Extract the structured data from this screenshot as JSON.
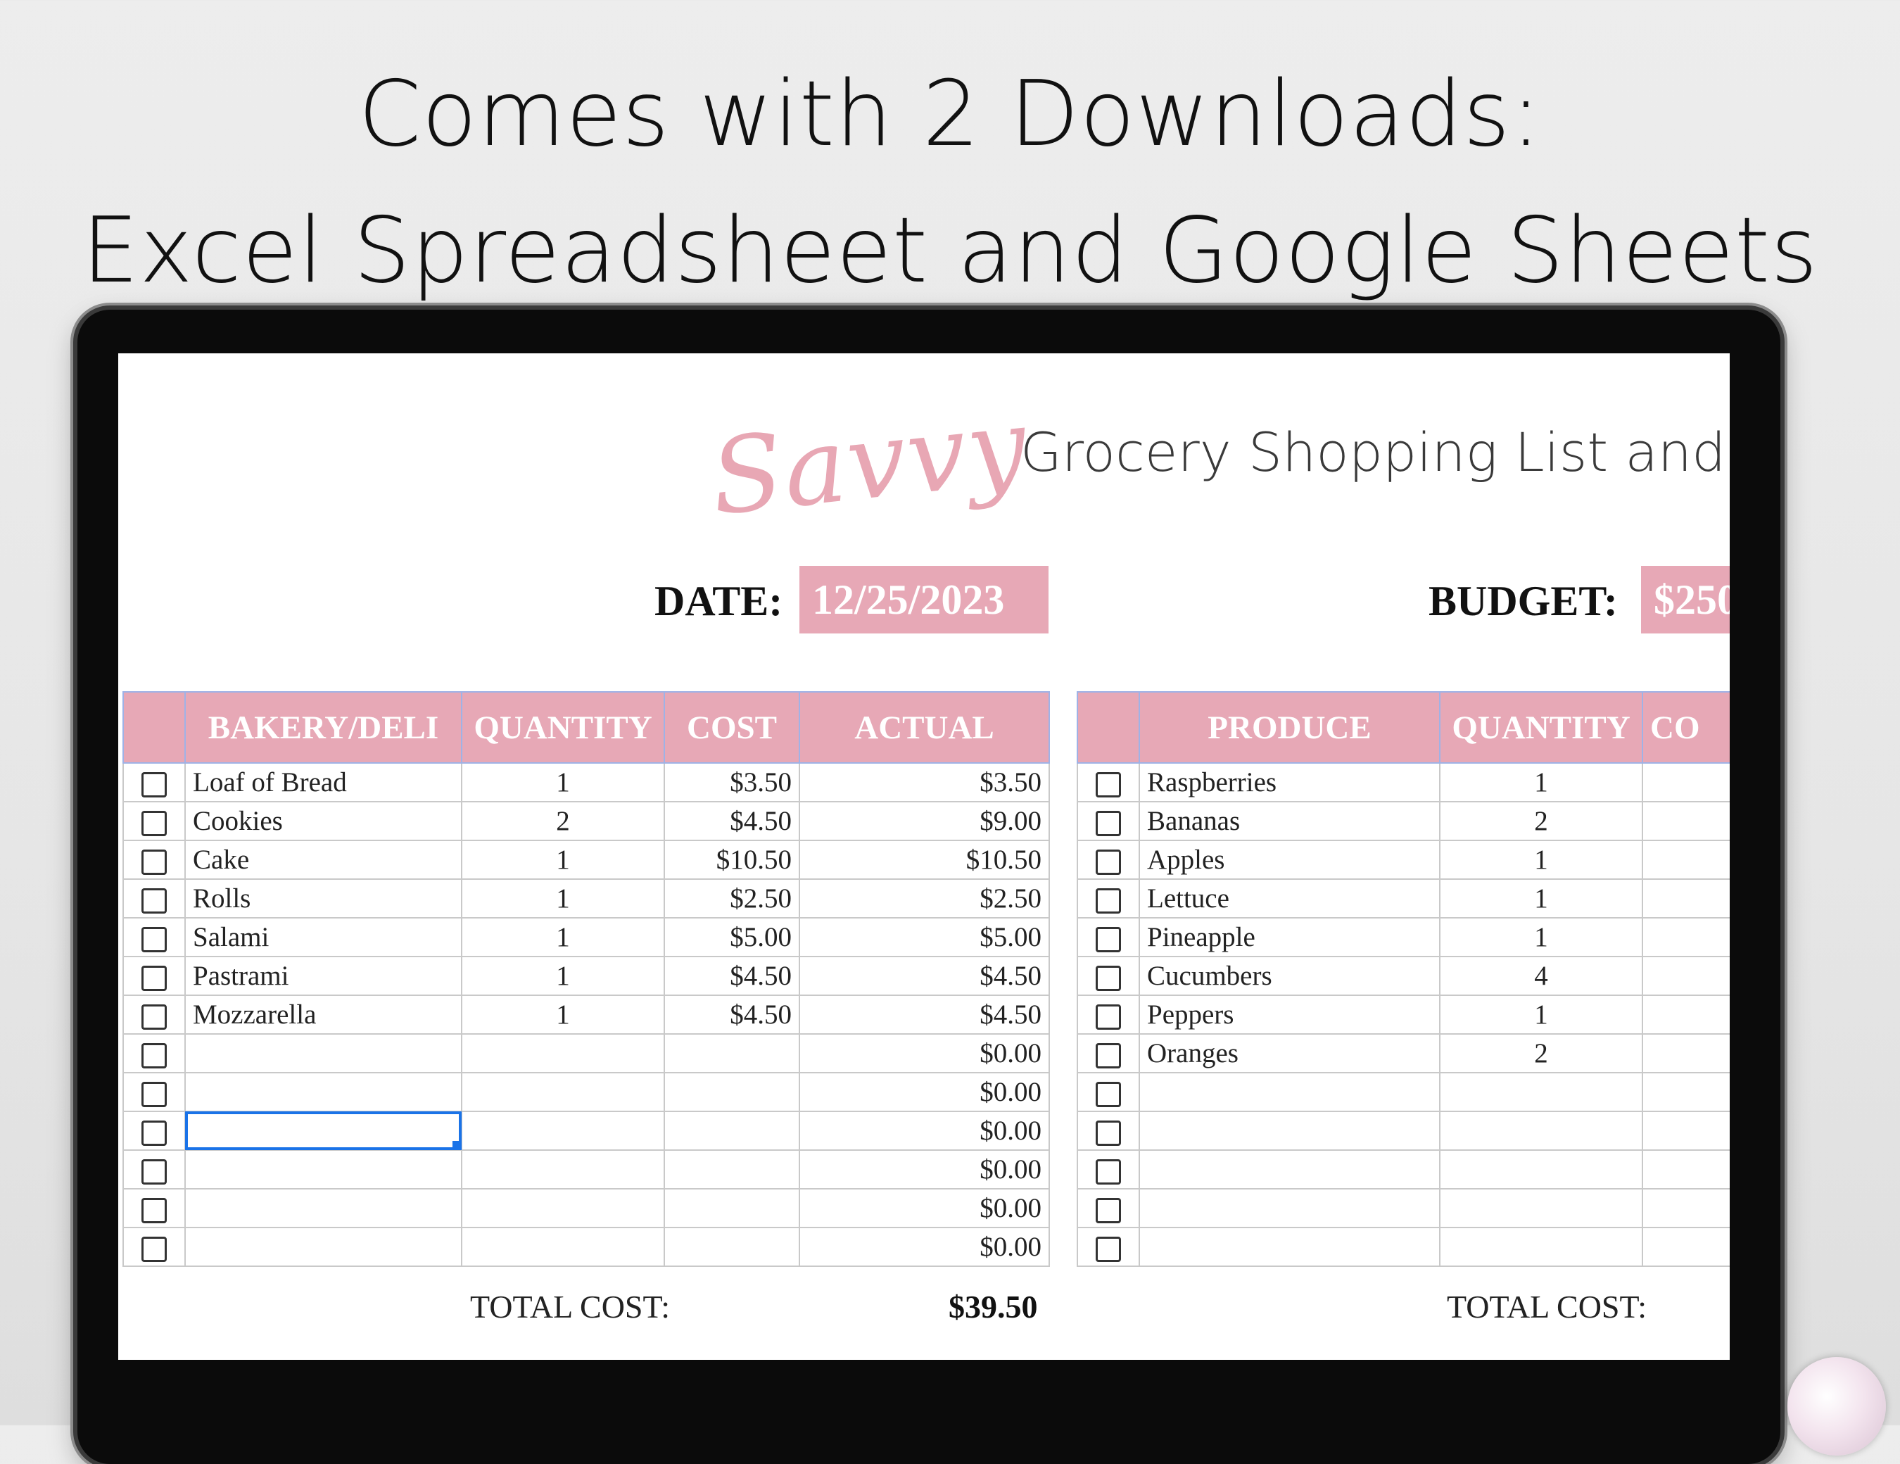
{
  "headline": {
    "line1": "Comes with 2 Downloads:",
    "line2": "Excel Spreadsheet and Google Sheets"
  },
  "sheet": {
    "logo": "Savvy",
    "title": "Grocery Shopping List and Bu",
    "date_label": "DATE:",
    "date_value": "12/25/2023",
    "budget_label": "BUDGET:",
    "budget_value": "$250"
  },
  "bakery": {
    "headers": [
      "",
      "BAKERY/DELI",
      "QUANTITY",
      "COST",
      "ACTUAL"
    ],
    "rows": [
      {
        "item": "Loaf of Bread",
        "qty": "1",
        "cost": "$3.50",
        "actual": "$3.50"
      },
      {
        "item": "Cookies",
        "qty": "2",
        "cost": "$4.50",
        "actual": "$9.00"
      },
      {
        "item": "Cake",
        "qty": "1",
        "cost": "$10.50",
        "actual": "$10.50"
      },
      {
        "item": "Rolls",
        "qty": "1",
        "cost": "$2.50",
        "actual": "$2.50"
      },
      {
        "item": "Salami",
        "qty": "1",
        "cost": "$5.00",
        "actual": "$5.00"
      },
      {
        "item": "Pastrami",
        "qty": "1",
        "cost": "$4.50",
        "actual": "$4.50"
      },
      {
        "item": "Mozzarella",
        "qty": "1",
        "cost": "$4.50",
        "actual": "$4.50"
      },
      {
        "item": "",
        "qty": "",
        "cost": "",
        "actual": "$0.00"
      },
      {
        "item": "",
        "qty": "",
        "cost": "",
        "actual": "$0.00"
      },
      {
        "item": "",
        "qty": "",
        "cost": "",
        "actual": "$0.00"
      },
      {
        "item": "",
        "qty": "",
        "cost": "",
        "actual": "$0.00"
      },
      {
        "item": "",
        "qty": "",
        "cost": "",
        "actual": "$0.00"
      },
      {
        "item": "",
        "qty": "",
        "cost": "",
        "actual": "$0.00"
      }
    ],
    "total_label": "TOTAL COST:",
    "total_value": "$39.50"
  },
  "produce": {
    "headers": [
      "",
      "PRODUCE",
      "QUANTITY",
      "CO"
    ],
    "rows": [
      {
        "item": "Raspberries",
        "qty": "1"
      },
      {
        "item": "Bananas",
        "qty": "2"
      },
      {
        "item": "Apples",
        "qty": "1"
      },
      {
        "item": "Lettuce",
        "qty": "1"
      },
      {
        "item": "Pineapple",
        "qty": "1"
      },
      {
        "item": "Cucumbers",
        "qty": "4"
      },
      {
        "item": "Peppers",
        "qty": "1"
      },
      {
        "item": "Oranges",
        "qty": "2"
      },
      {
        "item": "",
        "qty": ""
      },
      {
        "item": "",
        "qty": ""
      },
      {
        "item": "",
        "qty": ""
      },
      {
        "item": "",
        "qty": ""
      },
      {
        "item": "",
        "qty": ""
      }
    ],
    "total_label": "TOTAL COST:"
  },
  "colors": {
    "header_pink": "#e7a8b6",
    "selection_blue": "#1a73e8"
  }
}
